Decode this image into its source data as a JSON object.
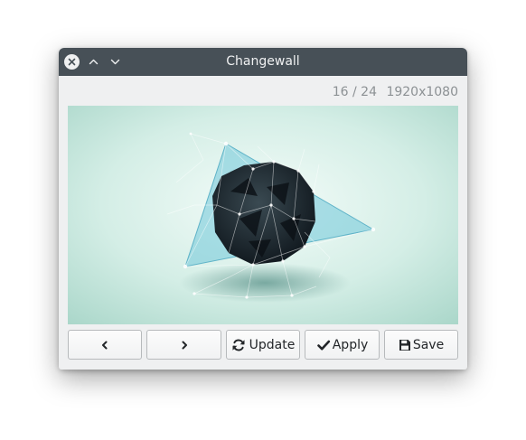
{
  "window": {
    "title": "Changewall"
  },
  "info": {
    "index": "16 / 24",
    "resolution": "1920x1080"
  },
  "buttons": {
    "previous_icon": "chevron-left-icon",
    "next_icon": "chevron-right-icon",
    "update_label": "Update",
    "apply_label": "Apply",
    "save_label": "Save"
  },
  "colors": {
    "titlebar": "#475057",
    "window_bg": "#eff0f1",
    "info_text": "#8c9194"
  }
}
